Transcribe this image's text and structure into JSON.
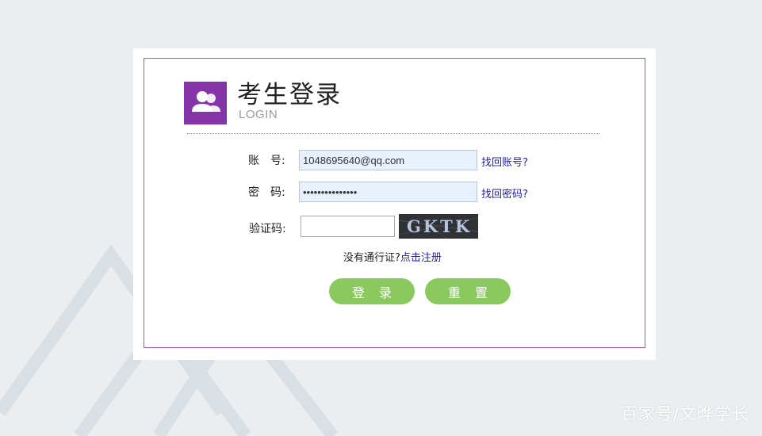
{
  "header": {
    "title": "考生登录",
    "subtitle": "LOGIN",
    "logo_icon": "users-icon"
  },
  "form": {
    "account_label": "账　号:",
    "account_value": "1048695640@qq.com",
    "recover_account_link": "找回账号?",
    "password_label": "密　码:",
    "password_value": "•••••••••••••••",
    "recover_password_link": "找回密码?",
    "captcha_label": "验证码:",
    "captcha_value": "",
    "captcha_text": "GKTK"
  },
  "register": {
    "prompt": "没有通行证?",
    "link": "点击注册"
  },
  "buttons": {
    "login": "登录",
    "reset": "重置"
  },
  "watermark": "百家号/文晔学长",
  "colors": {
    "brand_purple": "#8534a8",
    "frame_border": "#a25fbd",
    "button_green": "#8ac95d",
    "link_blue": "#1f1fa8",
    "autofill_bg": "#e8f0fe"
  }
}
